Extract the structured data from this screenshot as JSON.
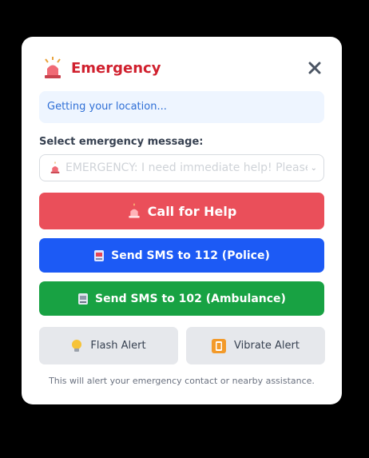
{
  "header": {
    "title": "Emergency",
    "close_icon": "close-icon"
  },
  "location": {
    "status_text": "Getting your location..."
  },
  "message_select": {
    "label": "Select emergency message:",
    "selected_value": "EMERGENCY: I need immediate help! Please",
    "icon": "siren-icon"
  },
  "buttons": {
    "call_label": "Call for Help",
    "police_label": "Send SMS to 112 (Police)",
    "ambulance_label": "Send SMS to 102 (Ambulance)",
    "flash_label": "Flash Alert",
    "vibrate_label": "Vibrate Alert"
  },
  "footer": {
    "text": "This will alert your emergency contact or nearby assistance."
  },
  "colors": {
    "title": "#d0202e",
    "call_button": "#ea4f5a",
    "police_button": "#1c5af5",
    "ambulance_button": "#18a243",
    "secondary_button": "#e6e8ec",
    "location_bg": "#eef5ff"
  }
}
